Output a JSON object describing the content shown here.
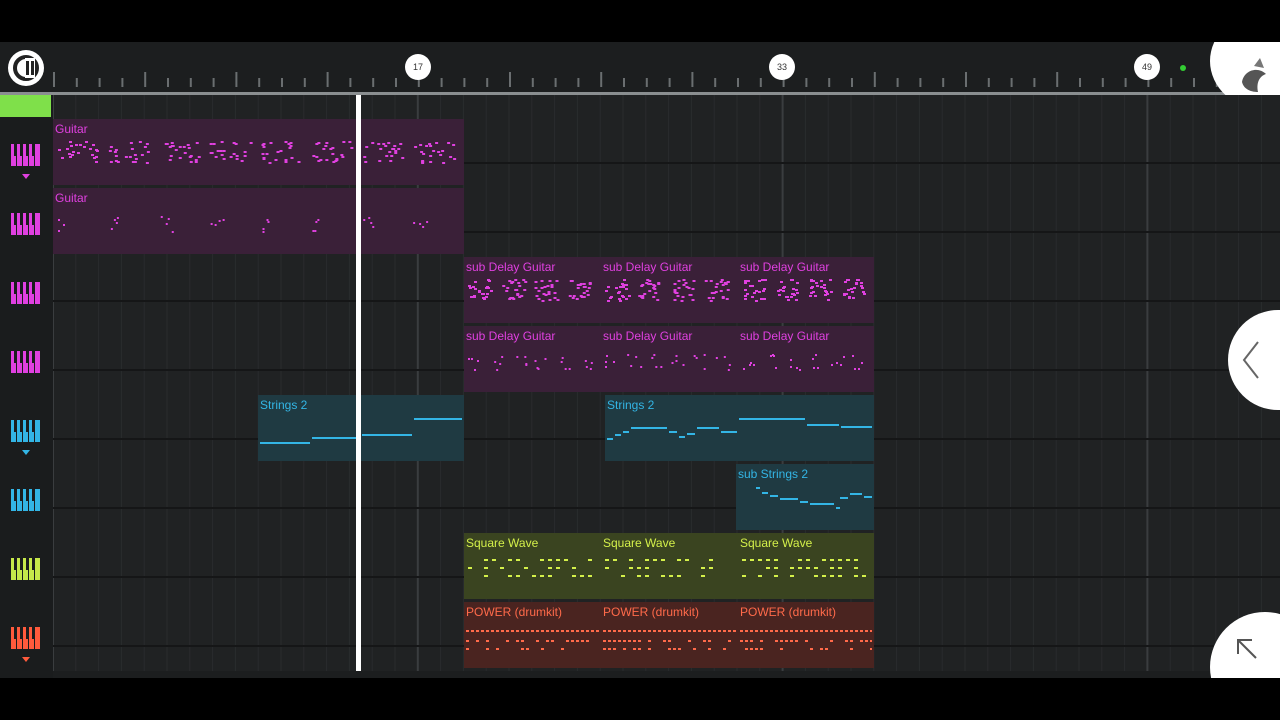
{
  "ruler": {
    "markers": [
      "17",
      "33",
      "49"
    ]
  },
  "tracks": [
    {
      "color": "#e040e0",
      "selected": true
    },
    {
      "color": "#e040e0"
    },
    {
      "color": "#e040e0"
    },
    {
      "color": "#e040e0"
    },
    {
      "color": "#33b5e5",
      "selected": true
    },
    {
      "color": "#33b5e5"
    },
    {
      "color": "#c6e84a"
    },
    {
      "color": "#ff5a3c",
      "selected": true
    }
  ],
  "clips": {
    "guitar_1": "Guitar",
    "guitar_2": "Guitar",
    "delay_row1": [
      "sub Delay Guitar",
      "sub Delay Guitar",
      "sub Delay Guitar"
    ],
    "delay_row2": [
      "sub Delay Guitar",
      "sub Delay Guitar",
      "sub Delay Guitar"
    ],
    "strings_a": "Strings 2",
    "strings_b": "Strings 2",
    "sub_strings": "sub Strings 2",
    "square": [
      "Square Wave",
      "Square Wave",
      "Square Wave"
    ],
    "power": [
      "POWER (drumkit)",
      "POWER (drumkit)",
      "POWER (drumkit)"
    ]
  },
  "colors": {
    "guitar_text": "#e040e0",
    "guitar_bg": "#3a2038",
    "strings_text": "#33b5e5",
    "strings_bg": "#1f3a42",
    "square_text": "#d4f04a",
    "square_bg": "#3a4420",
    "power_text": "#ff6a4a",
    "power_bg": "#4a2420"
  }
}
